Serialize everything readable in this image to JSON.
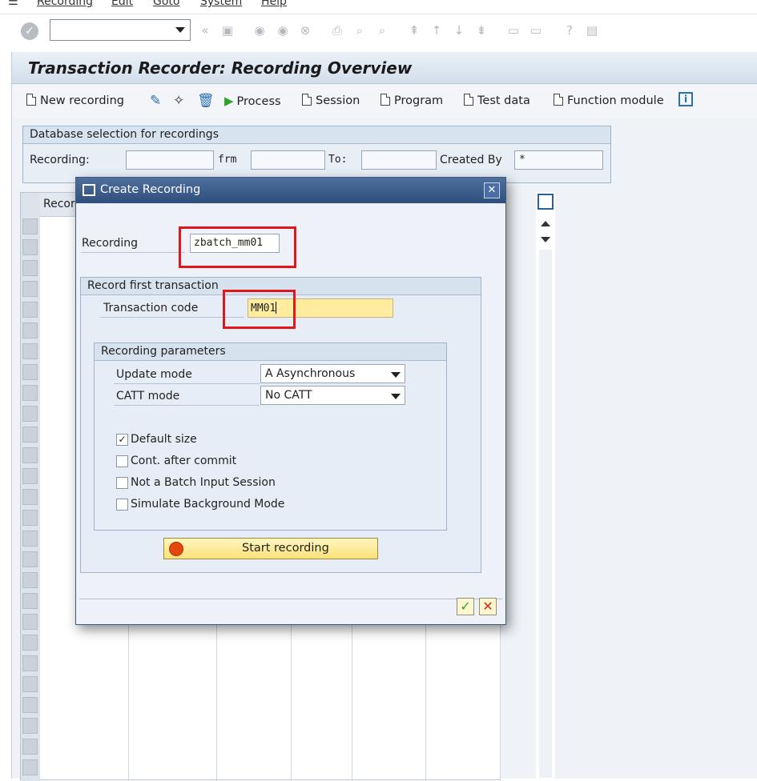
{
  "menubar": {
    "items": [
      "Recording",
      "Edit",
      "Goto",
      "System",
      "Help"
    ]
  },
  "command_field": {
    "value": ""
  },
  "window": {
    "title": "Transaction Recorder: Recording Overview"
  },
  "app_toolbar": {
    "new_recording": "New recording",
    "process": "Process",
    "session": "Session",
    "program": "Program",
    "test_data": "Test data",
    "function_module": "Function module"
  },
  "db_selection": {
    "header": "Database selection for recordings",
    "recording_label": "Recording:",
    "from_label": "frm",
    "to_label": "To:",
    "created_by_label": "Created By",
    "created_by_value": "*"
  },
  "grid": {
    "first_col_header": "Recor"
  },
  "dialog": {
    "title": "Create Recording",
    "recording_label": "Recording",
    "recording_value": "zbatch_mm01",
    "record_first_header": "Record first transaction",
    "tcode_label": "Transaction code",
    "tcode_value": "MM01",
    "params_header": "Recording parameters",
    "update_mode_label": "Update mode",
    "update_mode_value": "A Asynchronous",
    "catt_mode_label": "CATT mode",
    "catt_mode_value": "No CATT",
    "options": [
      {
        "label": "Default size",
        "checked": true
      },
      {
        "label": "Cont. after commit",
        "checked": false
      },
      {
        "label": "Not a Batch Input Session",
        "checked": false
      },
      {
        "label": "Simulate Background Mode",
        "checked": false
      }
    ],
    "start_button": "Start recording"
  },
  "colors": {
    "highlight": "#e4141b",
    "title_bar": "#2f4f7d",
    "required_field": "#ffec9e"
  }
}
